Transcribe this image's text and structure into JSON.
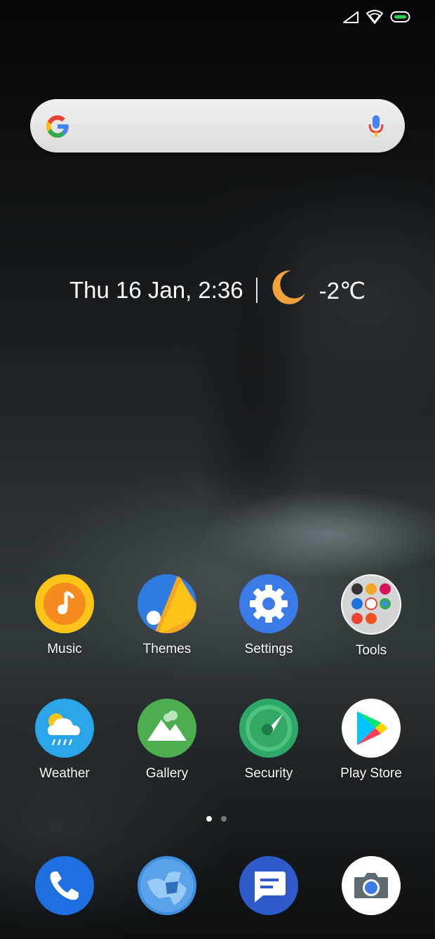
{
  "status_bar": {
    "icons": [
      "signal-icon",
      "wifi-icon",
      "battery-icon"
    ]
  },
  "search_bar": {
    "icons": [
      "google-g-icon",
      "microphone-icon"
    ]
  },
  "widget": {
    "date_time": "Thu 16 Jan, 2:36",
    "weather_icon": "moon-icon",
    "temperature": "-2℃"
  },
  "apps": [
    {
      "label": "Music",
      "icon": "music-icon"
    },
    {
      "label": "Themes",
      "icon": "themes-icon"
    },
    {
      "label": "Settings",
      "icon": "gear-icon"
    },
    {
      "label": "Tools",
      "icon": "folder-icon"
    },
    {
      "label": "Weather",
      "icon": "weather-icon"
    },
    {
      "label": "Gallery",
      "icon": "gallery-icon"
    },
    {
      "label": "Security",
      "icon": "security-icon"
    },
    {
      "label": "Play Store",
      "icon": "play-store-icon"
    }
  ],
  "page_indicator": {
    "pages": 2,
    "current": 1
  },
  "dock": [
    {
      "icon": "phone-icon"
    },
    {
      "icon": "browser-icon"
    },
    {
      "icon": "messages-icon"
    },
    {
      "icon": "camera-icon"
    }
  ],
  "colors": {
    "music": "#f5a623",
    "themes": "#2f7de1",
    "settings": "#3b7be8",
    "weather": "#2aa6e8",
    "gallery": "#4cae4f",
    "security": "#2ea868",
    "phone": "#1e6fe0",
    "browser": "#3d8fe0",
    "messages": "#2e5bc9",
    "camera": "#ffffff",
    "moon": "#f2a23a"
  }
}
